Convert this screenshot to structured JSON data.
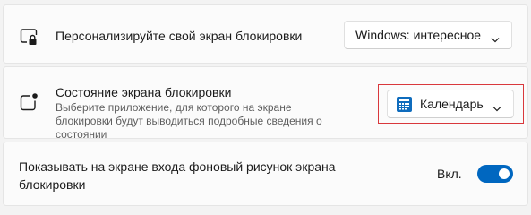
{
  "lock_screen_background": {
    "icon": "lock-screen-icon",
    "title": "Персонализируйте свой экран блокировки",
    "dropdown_value": "Windows: интересное"
  },
  "lock_screen_status": {
    "icon": "status-app-icon",
    "title": "Состояние экрана блокировки",
    "description": "Выберите приложение, для которого на экране блокировки будут выводиться подробные сведения о состоянии",
    "dropdown_value": "Календарь",
    "dropdown_icon": "calendar-icon"
  },
  "signin_background": {
    "title": "Показывать на экране входа фоновый рисунок экрана блокировки",
    "toggle_label": "Вкл.",
    "toggle_on": true
  },
  "colors": {
    "accent": "#0067c0",
    "highlight_border": "#d9383c",
    "calendar_icon": "#0f6cbd"
  }
}
